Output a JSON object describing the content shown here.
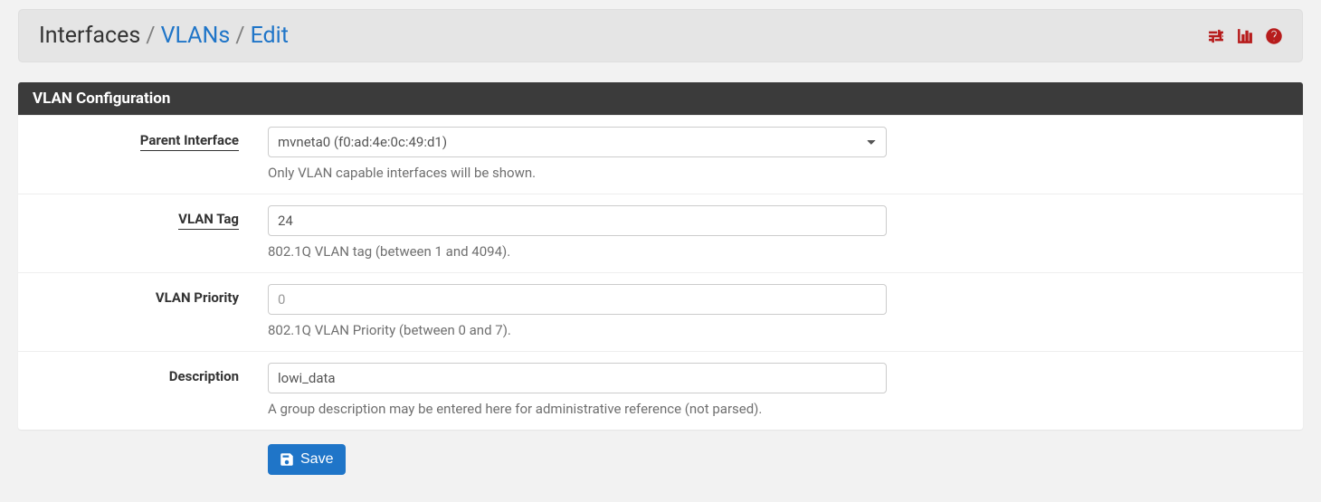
{
  "breadcrumb": {
    "root": "Interfaces",
    "separator": "/",
    "items": [
      {
        "label": "VLANs"
      },
      {
        "label": "Edit"
      }
    ]
  },
  "panel": {
    "title": "VLAN Configuration"
  },
  "fields": {
    "parent_interface": {
      "label": "Parent Interface",
      "value": "mvneta0 (f0:ad:4e:0c:49:d1)",
      "help": "Only VLAN capable interfaces will be shown."
    },
    "vlan_tag": {
      "label": "VLAN Tag",
      "value": "24",
      "help": "802.1Q VLAN tag (between 1 and 4094)."
    },
    "vlan_priority": {
      "label": "VLAN Priority",
      "placeholder": "0",
      "value": "",
      "help": "802.1Q VLAN Priority (between 0 and 7)."
    },
    "description": {
      "label": "Description",
      "value": "lowi_data",
      "help": "A group description may be entered here for administrative reference (not parsed)."
    }
  },
  "buttons": {
    "save": "Save"
  }
}
